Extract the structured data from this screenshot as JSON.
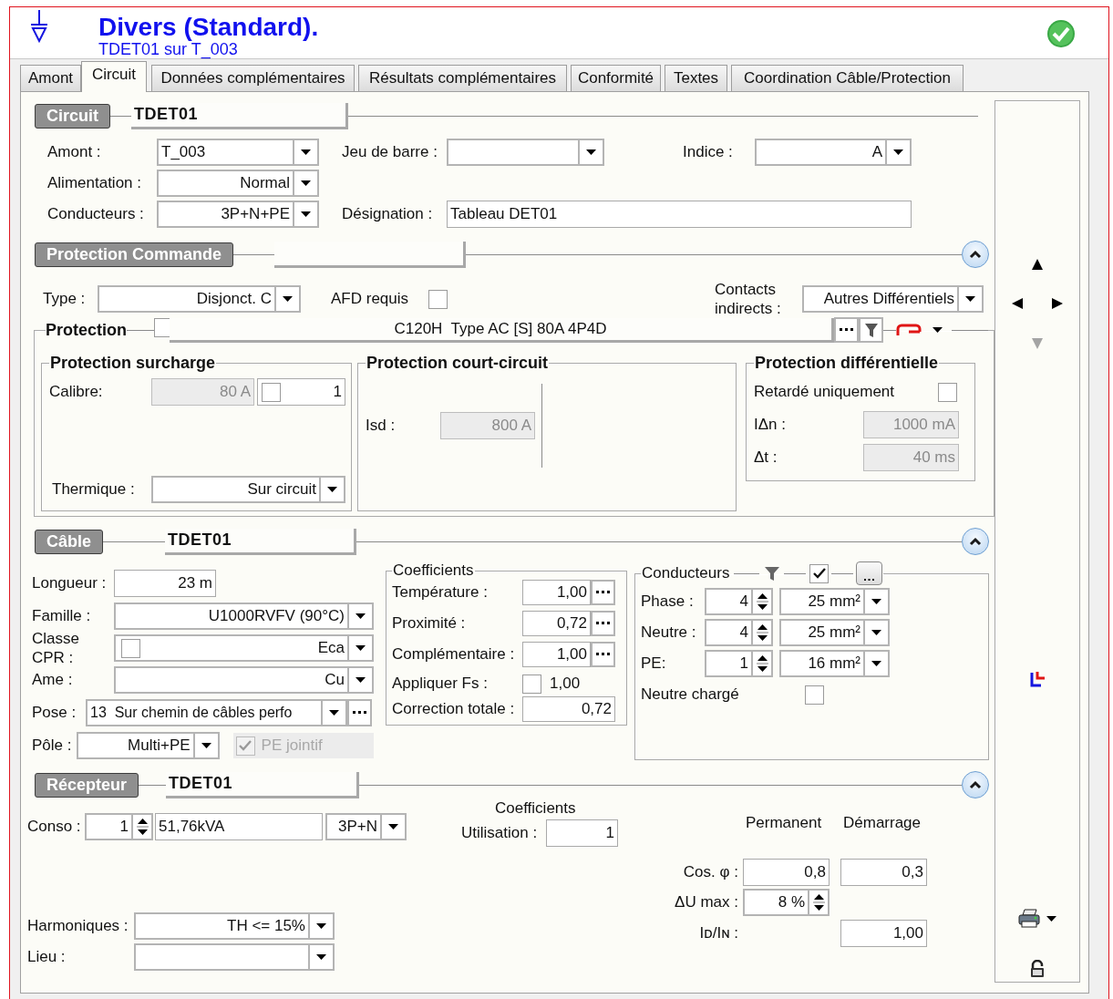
{
  "header": {
    "title": "Divers (Standard).",
    "subtitle": "TDET01 sur T_003",
    "valid": true
  },
  "tabs": [
    {
      "label": "Amont",
      "selected": false
    },
    {
      "label": "Circuit",
      "selected": true
    },
    {
      "label": "Données complémentaires",
      "selected": false
    },
    {
      "label": "Résultats complémentaires",
      "selected": false
    },
    {
      "label": "Conformité",
      "selected": false
    },
    {
      "label": "Textes",
      "selected": false
    },
    {
      "label": "Coordination Câble/Protection",
      "selected": false
    }
  ],
  "circuit": {
    "heading": "Circuit",
    "name": "TDET01",
    "amont": {
      "label": "Amont :",
      "value": "T_003"
    },
    "jeu_de_barre": {
      "label": "Jeu de barre :"
    },
    "indice": {
      "label": "Indice :",
      "value": "A"
    },
    "alimentation": {
      "label": "Alimentation :",
      "value": "Normal"
    },
    "conducteurs": {
      "label": "Conducteurs :",
      "value": "3P+N+PE"
    },
    "designation": {
      "label": "Désignation :",
      "value": "Tableau DET01"
    }
  },
  "protection_commande": {
    "heading": "Protection Commande",
    "expanded": true,
    "type": {
      "label": "Type :",
      "value": "Disjonct. C"
    },
    "afd": {
      "label": "AFD requis",
      "checked": false
    },
    "contacts": {
      "label": "Contacts indirects :",
      "value": "Autres Différentiels"
    },
    "protection": {
      "title": "Protection",
      "checked": false,
      "device": "C120H  Type AC [S] 80A 4P4D",
      "surcharge": {
        "title": "Protection surcharge",
        "calibre": {
          "label": "Calibre:",
          "value": "80 A",
          "disabled": true
        },
        "calibre_option": {
          "checked": false,
          "value": "1"
        },
        "thermique": {
          "label": "Thermique :",
          "value": "Sur circuit"
        }
      },
      "court_circuit": {
        "title": "Protection court-circuit",
        "isd": {
          "label": "Isd :",
          "value": "800 A",
          "disabled": true
        }
      },
      "differentielle": {
        "title": "Protection différentielle",
        "retarde": {
          "label": "Retardé uniquement",
          "checked": false
        },
        "idn": {
          "label": "IΔn :",
          "value": "1000 mA",
          "disabled": true
        },
        "dt": {
          "label": "Δt :",
          "value": "40 ms",
          "disabled": true
        }
      }
    }
  },
  "cable": {
    "heading": "Câble",
    "name": "TDET01",
    "expanded": true,
    "longueur": {
      "label": "Longueur :",
      "value": "23 m"
    },
    "famille": {
      "label": "Famille :",
      "value": "U1000RVFV (90°C)"
    },
    "classe_cpr": {
      "label": "Classe CPR :",
      "value": "Eca",
      "checked": false
    },
    "ame": {
      "label": "Ame :",
      "value": "Cu"
    },
    "pose": {
      "label": "Pose :",
      "value": "13  Sur chemin de câbles perfo"
    },
    "pole": {
      "label": "Pôle :",
      "value": "Multi+PE"
    },
    "pe_jointif": {
      "label": "PE jointif",
      "checked": true,
      "disabled": true
    },
    "coefficients": {
      "title": "Coefficients",
      "rows": [
        {
          "label": "Température :",
          "value": "1,00",
          "kind": "more"
        },
        {
          "label": "Proximité :",
          "value": "0,72",
          "kind": "more"
        },
        {
          "label": "Complémentaire :",
          "value": "1,00",
          "kind": "more"
        },
        {
          "label": "Appliquer Fs :",
          "value": "1,00",
          "kind": "check",
          "checked": false
        },
        {
          "label": "Correction totale :",
          "value": "0,72",
          "kind": "plain"
        }
      ]
    },
    "conducteurs": {
      "title": "Conducteurs",
      "filter_checked": true,
      "rows": [
        {
          "label": "Phase :",
          "count": "4",
          "section": "25 mm²"
        },
        {
          "label": "Neutre :",
          "count": "4",
          "section": "25 mm²"
        },
        {
          "label": "PE:",
          "count": "1",
          "section": "16 mm²"
        }
      ],
      "neutre_charge": {
        "label": "Neutre chargé",
        "checked": false
      }
    }
  },
  "recepteur": {
    "heading": "Récepteur",
    "name": "TDET01",
    "expanded": true,
    "conso": {
      "label": "Conso :",
      "count": "1",
      "power": "51,76kVA",
      "phases": "3P+N"
    },
    "coefficients_title": "Coefficients",
    "utilisation": {
      "label": "Utilisation :",
      "value": "1"
    },
    "permanent": "Permanent",
    "demarrage": "Démarrage",
    "cos": {
      "label": "Cos. φ :",
      "permanent": "0,8",
      "demarrage": "0,3"
    },
    "du_max": {
      "label": "ΔU max :",
      "value": "8 %"
    },
    "id_in": {
      "label": "Iᴅ/Iɴ :",
      "demarrage": "1,00"
    },
    "harmoniques": {
      "label": "Harmoniques :",
      "value": "TH <= 15%"
    },
    "lieu": {
      "label": "Lieu :"
    }
  },
  "sidebar": {
    "navigation": [
      {
        "kind": "up",
        "disabled": false
      },
      {
        "kind": "left",
        "disabled": false
      },
      {
        "kind": "right",
        "disabled": false
      },
      {
        "kind": "down",
        "disabled": true
      }
    ]
  }
}
